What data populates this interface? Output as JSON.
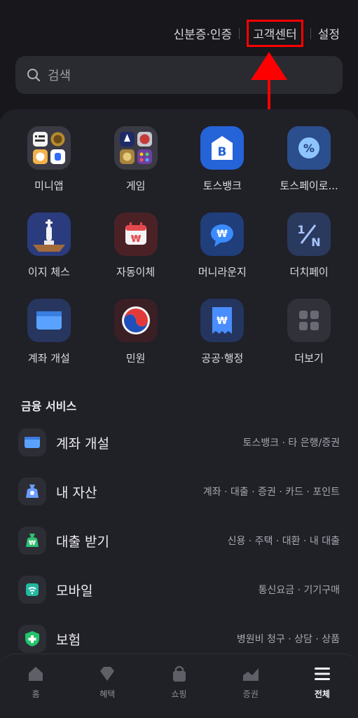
{
  "header": {
    "links": [
      {
        "label": "신분증·인증"
      },
      {
        "label": "고객센터"
      },
      {
        "label": "설정"
      }
    ]
  },
  "search": {
    "placeholder": "검색"
  },
  "grid": {
    "items": [
      {
        "label": "미니앱",
        "icon": "miniapp-icon"
      },
      {
        "label": "게임",
        "icon": "game-icon"
      },
      {
        "label": "토스뱅크",
        "icon": "tossbank-icon"
      },
      {
        "label": "토스페이로...",
        "icon": "tosspay-icon"
      },
      {
        "label": "이지 체스",
        "icon": "chess-icon"
      },
      {
        "label": "자동이체",
        "icon": "autotransfer-icon"
      },
      {
        "label": "머니라운지",
        "icon": "moneylounge-icon"
      },
      {
        "label": "더치페이",
        "icon": "dutchpay-icon"
      },
      {
        "label": "계좌 개설",
        "icon": "account-open-icon"
      },
      {
        "label": "민원",
        "icon": "civil-service-icon"
      },
      {
        "label": "공공·행정",
        "icon": "public-admin-icon"
      },
      {
        "label": "더보기",
        "icon": "more-icon"
      }
    ]
  },
  "finance": {
    "title": "금융 서비스",
    "items": [
      {
        "name": "계좌 개설",
        "sub": "토스뱅크 · 타 은행/증권",
        "icon": "account-card-icon"
      },
      {
        "name": "내 자산",
        "sub": "계좌 · 대출 · 증권 · 카드 · 포인트",
        "icon": "asset-bag-icon"
      },
      {
        "name": "대출 받기",
        "sub": "신용 · 주택 · 대환 · 내 대출",
        "icon": "loan-bag-icon"
      },
      {
        "name": "모바일",
        "sub": "통신요금 · 기기구매",
        "icon": "mobile-wifi-icon"
      },
      {
        "name": "보험",
        "sub": "병원비 청구 · 상담 · 상품",
        "icon": "insurance-shield-icon"
      }
    ]
  },
  "nav": {
    "items": [
      {
        "label": "홈",
        "icon": "home-icon"
      },
      {
        "label": "혜택",
        "icon": "benefit-icon"
      },
      {
        "label": "쇼핑",
        "icon": "shopping-icon"
      },
      {
        "label": "증권",
        "icon": "stock-icon"
      },
      {
        "label": "전체",
        "icon": "menu-icon"
      }
    ],
    "active": "전체"
  },
  "colors": {
    "highlight": "#ff0000",
    "accent": "#3182f6"
  }
}
